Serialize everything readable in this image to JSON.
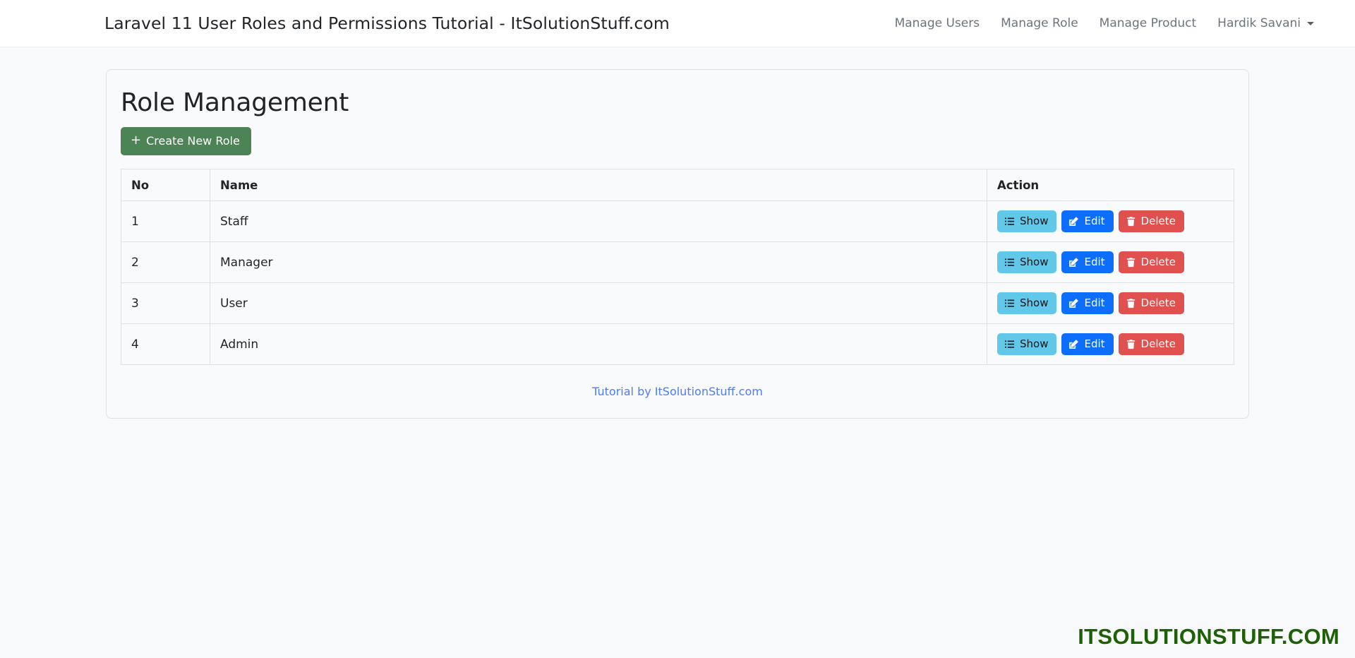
{
  "navbar": {
    "brand": "Laravel 11 User Roles and Permissions Tutorial - ItSolutionStuff.com",
    "links": [
      {
        "label": "Manage Users",
        "name": "nav-link-manage-users"
      },
      {
        "label": "Manage Role",
        "name": "nav-link-manage-role"
      },
      {
        "label": "Manage Product",
        "name": "nav-link-manage-product"
      }
    ],
    "user": {
      "label": "Hardik Savani",
      "caret_icon": "chevron-down-icon"
    }
  },
  "main": {
    "title": "Role Management",
    "create_button": {
      "label": "Create New Role",
      "icon": "plus-icon"
    },
    "table": {
      "columns": [
        "No",
        "Name",
        "Action"
      ],
      "rows": [
        {
          "no": "1",
          "name": "Staff"
        },
        {
          "no": "2",
          "name": "Manager"
        },
        {
          "no": "3",
          "name": "User"
        },
        {
          "no": "4",
          "name": "Admin"
        }
      ],
      "row_actions": [
        {
          "label": "Show",
          "icon": "list-ul-icon",
          "name": "show-button"
        },
        {
          "label": "Edit",
          "icon": "pencil-square-icon",
          "name": "edit-button"
        },
        {
          "label": "Delete",
          "icon": "trash-icon",
          "name": "delete-button"
        }
      ]
    },
    "tutorial_link": "Tutorial by ItSolutionStuff.com"
  },
  "watermark": "ITSOLUTIONSTUFF.COM",
  "colors": {
    "page_background": "#f8f9fa",
    "navbar_background": "#ffffff",
    "create_green": "#4c8455",
    "show_cyan": "#62c8ea",
    "edit_blue": "#0d6efd",
    "delete_red": "#e0504f",
    "link_blue": "#4d7cfe",
    "watermark_green": "#1f6007",
    "border_gray": "#dee2e6"
  }
}
